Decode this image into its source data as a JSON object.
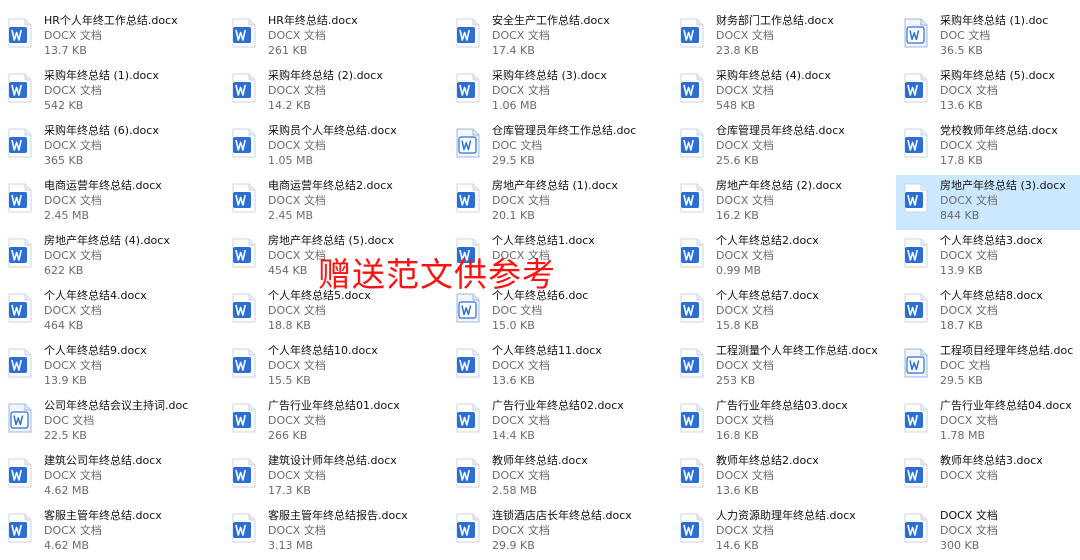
{
  "overlay_text": "赠送范文供参考",
  "files": [
    {
      "name": "HR个人年终工作总结.docx",
      "type": "DOCX 文档",
      "size": "13.7 KB",
      "icon": "docx-file-icon"
    },
    {
      "name": "HR年终总结.docx",
      "type": "DOCX 文档",
      "size": "261 KB",
      "icon": "docx-file-icon"
    },
    {
      "name": "安全生产工作总结.docx",
      "type": "DOCX 文档",
      "size": "17.4 KB",
      "icon": "docx-file-icon"
    },
    {
      "name": "财务部门工作总结.docx",
      "type": "DOCX 文档",
      "size": "23.8 KB",
      "icon": "docx-file-icon"
    },
    {
      "name": "采购年终总结 (1).doc",
      "type": "DOC 文档",
      "size": "36.5 KB",
      "icon": "doc-file-icon"
    },
    {
      "name": "采购年终总结 (1).docx",
      "type": "DOCX 文档",
      "size": "542 KB",
      "icon": "docx-file-icon"
    },
    {
      "name": "采购年终总结 (2).docx",
      "type": "DOCX 文档",
      "size": "14.2 KB",
      "icon": "docx-file-icon"
    },
    {
      "name": "采购年终总结 (3).docx",
      "type": "DOCX 文档",
      "size": "1.06 MB",
      "icon": "docx-file-icon"
    },
    {
      "name": "采购年终总结 (4).docx",
      "type": "DOCX 文档",
      "size": "548 KB",
      "icon": "docx-file-icon"
    },
    {
      "name": "采购年终总结 (5).docx",
      "type": "DOCX 文档",
      "size": "13.6 KB",
      "icon": "docx-file-icon"
    },
    {
      "name": "采购年终总结 (6).docx",
      "type": "DOCX 文档",
      "size": "365 KB",
      "icon": "docx-file-icon"
    },
    {
      "name": "采购员个人年终总结.docx",
      "type": "DOCX 文档",
      "size": "1.05 MB",
      "icon": "docx-file-icon"
    },
    {
      "name": "仓库管理员年终工作总结.doc",
      "type": "DOC 文档",
      "size": "29.5 KB",
      "icon": "doc-file-icon"
    },
    {
      "name": "仓库管理员年终总结.docx",
      "type": "DOCX 文档",
      "size": "25.6 KB",
      "icon": "docx-file-icon"
    },
    {
      "name": "党校教师年终总结.docx",
      "type": "DOCX 文档",
      "size": "17.8 KB",
      "icon": "docx-file-icon"
    },
    {
      "name": "电商运营年终总结.docx",
      "type": "DOCX 文档",
      "size": "2.45 MB",
      "icon": "docx-file-icon"
    },
    {
      "name": "电商运营年终总结2.docx",
      "type": "DOCX 文档",
      "size": "2.45 MB",
      "icon": "docx-file-icon"
    },
    {
      "name": "房地产年终总结 (1).docx",
      "type": "DOCX 文档",
      "size": "20.1 KB",
      "icon": "docx-file-icon"
    },
    {
      "name": "房地产年终总结 (2).docx",
      "type": "DOCX 文档",
      "size": "16.2 KB",
      "icon": "docx-file-icon"
    },
    {
      "name": "房地产年终总结 (3).docx",
      "type": "DOCX 文档",
      "size": "844 KB",
      "icon": "docx-file-icon",
      "selected": true
    },
    {
      "name": "房地产年终总结 (4).docx",
      "type": "DOCX 文档",
      "size": "622 KB",
      "icon": "docx-file-icon"
    },
    {
      "name": "房地产年终总结 (5).docx",
      "type": "DOCX 文档",
      "size": "454 KB",
      "icon": "docx-file-icon"
    },
    {
      "name": "个人年终总结1.docx",
      "type": "DOCX 文档",
      "size": "",
      "icon": "docx-file-icon"
    },
    {
      "name": "个人年终总结2.docx",
      "type": "DOCX 文档",
      "size": "0.99 MB",
      "icon": "docx-file-icon"
    },
    {
      "name": "个人年终总结3.docx",
      "type": "DOCX 文档",
      "size": "13.9 KB",
      "icon": "docx-file-icon"
    },
    {
      "name": "个人年终总结4.docx",
      "type": "DOCX 文档",
      "size": "464 KB",
      "icon": "docx-file-icon"
    },
    {
      "name": "个人年终总结5.docx",
      "type": "DOCX 文档",
      "size": "18.8 KB",
      "icon": "docx-file-icon"
    },
    {
      "name": "个人年终总结6.doc",
      "type": "DOC 文档",
      "size": "15.0 KB",
      "icon": "doc-file-icon"
    },
    {
      "name": "个人年终总结7.docx",
      "type": "DOCX 文档",
      "size": "15.8 KB",
      "icon": "docx-file-icon"
    },
    {
      "name": "个人年终总结8.docx",
      "type": "DOCX 文档",
      "size": "18.7 KB",
      "icon": "docx-file-icon"
    },
    {
      "name": "个人年终总结9.docx",
      "type": "DOCX 文档",
      "size": "13.9 KB",
      "icon": "docx-file-icon"
    },
    {
      "name": "个人年终总结10.docx",
      "type": "DOCX 文档",
      "size": "15.5 KB",
      "icon": "docx-file-icon"
    },
    {
      "name": "个人年终总结11.docx",
      "type": "DOCX 文档",
      "size": "13.6 KB",
      "icon": "docx-file-icon"
    },
    {
      "name": "工程测量个人年终工作总结.docx",
      "type": "DOCX 文档",
      "size": "253 KB",
      "icon": "docx-file-icon"
    },
    {
      "name": "工程项目经理年终总结.doc",
      "type": "DOC 文档",
      "size": "29.5 KB",
      "icon": "doc-file-icon"
    },
    {
      "name": "公司年终总结会议主持词.doc",
      "type": "DOC 文档",
      "size": "22.5 KB",
      "icon": "doc-file-icon"
    },
    {
      "name": "广告行业年终总结01.docx",
      "type": "DOCX 文档",
      "size": "266 KB",
      "icon": "docx-file-icon"
    },
    {
      "name": "广告行业年终总结02.docx",
      "type": "DOCX 文档",
      "size": "14.4 KB",
      "icon": "docx-file-icon"
    },
    {
      "name": "广告行业年终总结03.docx",
      "type": "DOCX 文档",
      "size": "16.8 KB",
      "icon": "docx-file-icon"
    },
    {
      "name": "广告行业年终总结04.docx",
      "type": "DOCX 文档",
      "size": "1.78 MB",
      "icon": "docx-file-icon"
    },
    {
      "name": "建筑公司年终总结.docx",
      "type": "DOCX 文档",
      "size": "4.62 MB",
      "icon": "docx-file-icon"
    },
    {
      "name": "建筑设计师年终总结.docx",
      "type": "DOCX 文档",
      "size": "17.3 KB",
      "icon": "docx-file-icon"
    },
    {
      "name": "教师年终总结.docx",
      "type": "DOCX 文档",
      "size": "2.58 MB",
      "icon": "docx-file-icon"
    },
    {
      "name": "教师年终总结2.docx",
      "type": "DOCX 文档",
      "size": "13.6 KB",
      "icon": "docx-file-icon"
    },
    {
      "name": "教师年终总结3.docx",
      "type": "DOCX 文档",
      "size": "",
      "icon": "docx-file-icon"
    },
    {
      "name": "客服主管年终总结.docx",
      "type": "DOCX 文档",
      "size": "4.62 MB",
      "icon": "docx-file-icon"
    },
    {
      "name": "客服主管年终总结报告.docx",
      "type": "DOCX 文档",
      "size": "3.13 MB",
      "icon": "docx-file-icon"
    },
    {
      "name": "连锁酒店店长年终总结.docx",
      "type": "DOCX 文档",
      "size": "29.9 KB",
      "icon": "docx-file-icon"
    },
    {
      "name": "人力资源助理年终总结.docx",
      "type": "DOCX 文档",
      "size": "14.6 KB",
      "icon": "docx-file-icon"
    },
    {
      "name": "DOCX 文档",
      "type": "DOCX 文档",
      "size": "300 KB",
      "icon": "docx-file-icon"
    }
  ],
  "colors": {
    "docx_icon_bg": "#2b6fd6",
    "doc_icon_bg": "#ffffff",
    "doc_icon_fg": "#2b6fd6",
    "selected_bg": "#cce8ff",
    "overlay": "#ff1111"
  }
}
